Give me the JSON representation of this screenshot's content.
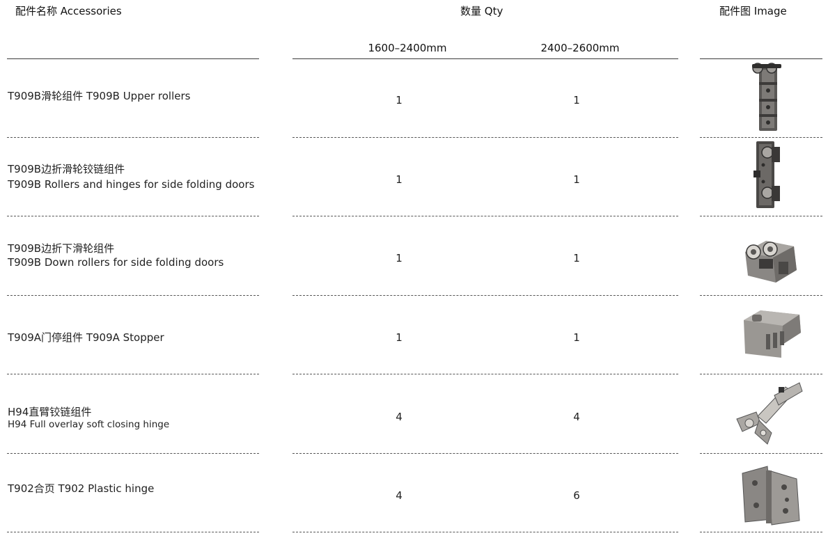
{
  "header": {
    "accessories": "配件名称  Accessories",
    "qty": "数量  Qty",
    "image": "配件图  Image",
    "range1": "1600–2400mm",
    "range2": "2400–2600mm"
  },
  "rows": [
    {
      "name_line1": "T909B滑轮组件  T909B Upper rollers",
      "name_line2": "",
      "qty1": "1",
      "qty2": "1",
      "image_icon": "upper-roller-icon"
    },
    {
      "name_line1": "T909B边折滑轮铰链组件",
      "name_line2": "T909B  Rollers and hinges for side folding doors",
      "qty1": "1",
      "qty2": "1",
      "image_icon": "roller-hinge-icon"
    },
    {
      "name_line1": "T909B边折下滑轮组件",
      "name_line2": "T909B Down rollers for side folding doors",
      "qty1": "1",
      "qty2": "1",
      "image_icon": "down-roller-icon"
    },
    {
      "name_line1": "T909A门停组件  T909A Stopper",
      "name_line2": "",
      "qty1": "1",
      "qty2": "1",
      "image_icon": "stopper-icon"
    },
    {
      "name_line1": "H94直臂铰链组件",
      "name_line2": "H94 Full overlay soft closing hinge",
      "qty1": "4",
      "qty2": "4",
      "image_icon": "soft-close-hinge-icon"
    },
    {
      "name_line1": "T902合页  T902 Plastic hinge",
      "name_line2": "",
      "qty1": "4",
      "qty2": "6",
      "image_icon": "plastic-hinge-icon"
    }
  ],
  "colors": {
    "text": "#1a1a1a",
    "rule": "#3a3a3a",
    "part_gray": "#8a8784",
    "part_dark": "#4a4846",
    "part_light": "#bdbab5"
  }
}
